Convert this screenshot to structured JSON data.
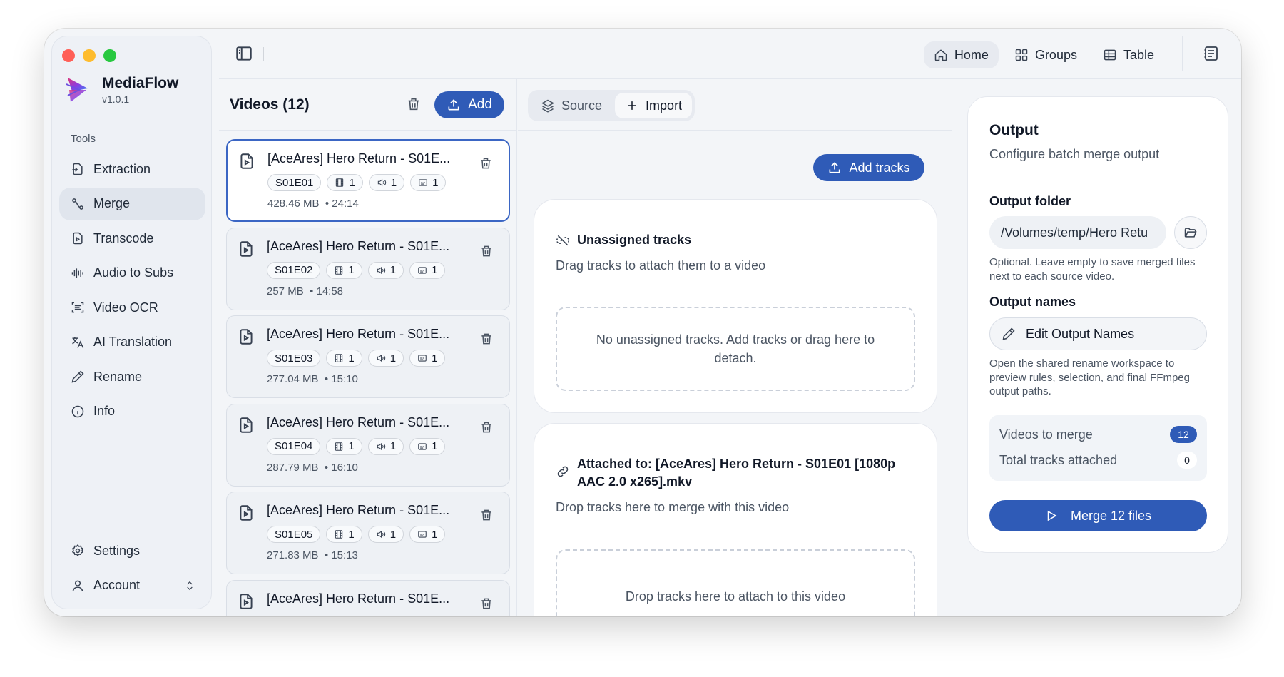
{
  "app": {
    "name": "MediaFlow",
    "version": "v1.0.1"
  },
  "sidebar": {
    "section_label": "Tools",
    "items": [
      {
        "label": "Extraction",
        "icon": "extraction-icon"
      },
      {
        "label": "Merge",
        "icon": "merge-icon",
        "active": true
      },
      {
        "label": "Transcode",
        "icon": "transcode-icon"
      },
      {
        "label": "Audio to Subs",
        "icon": "audio-wave-icon"
      },
      {
        "label": "Video OCR",
        "icon": "ocr-scan-icon"
      },
      {
        "label": "AI Translation",
        "icon": "translate-icon"
      },
      {
        "label": "Rename",
        "icon": "pencil-icon"
      },
      {
        "label": "Info",
        "icon": "info-icon"
      }
    ],
    "settings_label": "Settings",
    "account_label": "Account"
  },
  "topnav": {
    "items": [
      {
        "label": "Home",
        "active": true
      },
      {
        "label": "Groups"
      },
      {
        "label": "Table"
      }
    ]
  },
  "videos": {
    "title": "Videos (12)",
    "add_label": "Add",
    "items": [
      {
        "title": "[AceAres] Hero Return - S01E...",
        "episode": "S01E01",
        "video": "1",
        "audio": "1",
        "subs": "1",
        "size": "428.46 MB",
        "duration": "• 24:14",
        "selected": true
      },
      {
        "title": "[AceAres] Hero Return - S01E...",
        "episode": "S01E02",
        "video": "1",
        "audio": "1",
        "subs": "1",
        "size": "257 MB",
        "duration": "• 14:58"
      },
      {
        "title": "[AceAres] Hero Return - S01E...",
        "episode": "S01E03",
        "video": "1",
        "audio": "1",
        "subs": "1",
        "size": "277.04 MB",
        "duration": "• 15:10"
      },
      {
        "title": "[AceAres] Hero Return - S01E...",
        "episode": "S01E04",
        "video": "1",
        "audio": "1",
        "subs": "1",
        "size": "287.79 MB",
        "duration": "• 16:10"
      },
      {
        "title": "[AceAres] Hero Return - S01E...",
        "episode": "S01E05",
        "video": "1",
        "audio": "1",
        "subs": "1",
        "size": "271.83 MB",
        "duration": "• 15:13"
      },
      {
        "title": "[AceAres] Hero Return - S01E...",
        "episode": "",
        "video": "",
        "audio": "",
        "subs": "",
        "size": "",
        "duration": ""
      }
    ]
  },
  "tracks": {
    "tabs": [
      {
        "label": "Source"
      },
      {
        "label": "Import",
        "active": true
      }
    ],
    "add_tracks_label": "Add tracks",
    "unassigned": {
      "title": "Unassigned tracks",
      "subtitle": "Drag tracks to attach them to a video",
      "empty_text": "No unassigned tracks. Add tracks or drag here to detach."
    },
    "attached": {
      "title": "Attached to: [AceAres] Hero Return - S01E01 [1080p AAC 2.0 x265].mkv",
      "subtitle": "Drop tracks here to merge with this video",
      "drop_text": "Drop tracks here to attach to this video"
    }
  },
  "output": {
    "title": "Output",
    "subtitle": "Configure batch merge output",
    "folder_label": "Output folder",
    "folder_value": "/Volumes/temp/Hero Retu",
    "folder_hint": "Optional. Leave empty to save merged files next to each source video.",
    "names_label": "Output names",
    "edit_names_label": "Edit Output Names",
    "names_hint": "Open the shared rename workspace to preview rules, selection, and final FFmpeg output paths.",
    "stats": {
      "videos_label": "Videos to merge",
      "videos_value": "12",
      "tracks_label": "Total tracks attached",
      "tracks_value": "0"
    },
    "merge_label": "Merge 12 files"
  },
  "colors": {
    "accent": "#2f5bb7",
    "window_bg": "#f3f5f8",
    "card_bg": "#ffffff"
  }
}
